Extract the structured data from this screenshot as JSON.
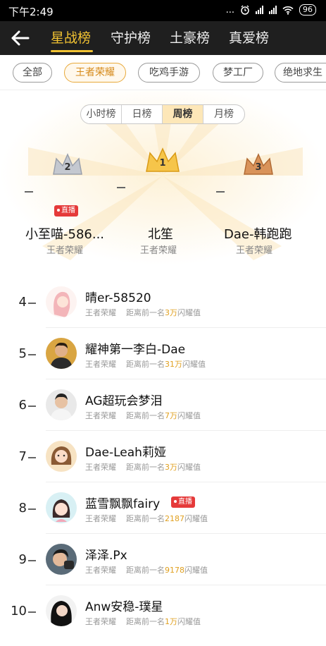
{
  "status_bar": {
    "time": "下午2:49",
    "dots": "...",
    "battery": "96"
  },
  "header": {
    "tabs": [
      {
        "label": "星战榜",
        "active": true
      },
      {
        "label": "守护榜",
        "active": false
      },
      {
        "label": "土豪榜",
        "active": false
      },
      {
        "label": "真爱榜",
        "active": false
      }
    ]
  },
  "categories": [
    {
      "label": "全部",
      "active": false
    },
    {
      "label": "王者荣耀",
      "active": true
    },
    {
      "label": "吃鸡手游",
      "active": false
    },
    {
      "label": "梦工厂",
      "active": false
    },
    {
      "label": "绝地求生",
      "active": false
    }
  ],
  "periods": [
    {
      "label": "小时榜",
      "active": false
    },
    {
      "label": "日榜",
      "active": false
    },
    {
      "label": "周榜",
      "active": true
    },
    {
      "label": "月榜",
      "active": false
    }
  ],
  "podium": [
    {
      "rank": "2",
      "name": "小至喵-586...",
      "game": "王者荣耀",
      "live_label": "直播"
    },
    {
      "rank": "1",
      "name": "北笙",
      "game": "王者荣耀"
    },
    {
      "rank": "3",
      "name": "Dae-韩跑跑",
      "game": "王者荣耀"
    }
  ],
  "list": [
    {
      "rank": "4",
      "name": "晴er-58520",
      "game": "王者荣耀",
      "gap_prefix": "距离前一名",
      "gap_value": "3万",
      "gap_suffix": "闪耀值"
    },
    {
      "rank": "5",
      "name": "耀神第一李白-Dae",
      "game": "王者荣耀",
      "gap_prefix": "距离前一名",
      "gap_value": "31万",
      "gap_suffix": "闪耀值"
    },
    {
      "rank": "6",
      "name": "AG超玩会梦泪",
      "game": "王者荣耀",
      "gap_prefix": "距离前一名",
      "gap_value": "7万",
      "gap_suffix": "闪耀值"
    },
    {
      "rank": "7",
      "name": "Dae-Leah莉娅",
      "game": "王者荣耀",
      "gap_prefix": "距离前一名",
      "gap_value": "3万",
      "gap_suffix": "闪耀值"
    },
    {
      "rank": "8",
      "name": "蓝雪飘飘fairy",
      "game": "王者荣耀",
      "gap_prefix": "距离前一名",
      "gap_value": "2187",
      "gap_suffix": "闪耀值",
      "live_label": "直播"
    },
    {
      "rank": "9",
      "name": "泽泽.Px",
      "game": "王者荣耀",
      "gap_prefix": "距离前一名",
      "gap_value": "9178",
      "gap_suffix": "闪耀值"
    },
    {
      "rank": "10",
      "name": "Anw安稳-璞星",
      "game": "王者荣耀",
      "gap_prefix": "距离前一名",
      "gap_value": "1万",
      "gap_suffix": "闪耀值"
    }
  ],
  "colors": {
    "accent": "#f1c232",
    "chip_active": "#d68a1a",
    "live": "#e53a3a",
    "gap_highlight": "#e0a020",
    "header_bg": "#1f1f1f"
  },
  "icons": {
    "back": "back-arrow-icon",
    "alarm": "alarm-icon",
    "signal": "signal-icon",
    "wifi": "wifi-icon",
    "battery": "battery-icon",
    "crown": "crown-icon"
  }
}
